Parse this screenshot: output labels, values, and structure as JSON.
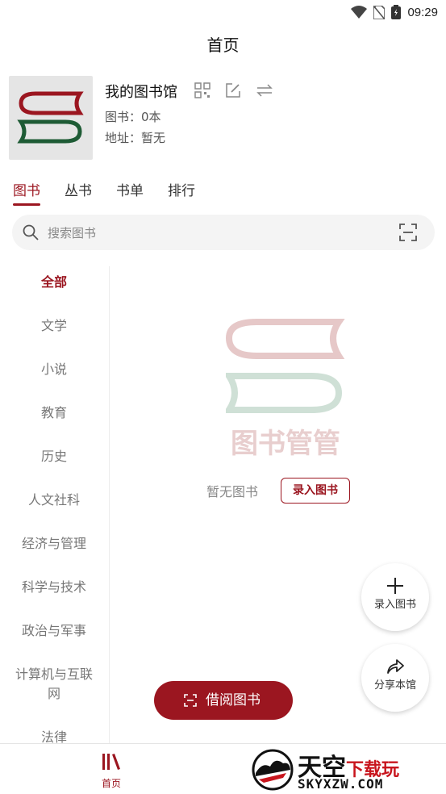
{
  "status": {
    "time": "09:29"
  },
  "page": {
    "title": "首页"
  },
  "library": {
    "name": "我的图书馆",
    "books": "图书：0本",
    "address": "地址：暂无"
  },
  "tabs": [
    {
      "label": "图书",
      "active": true
    },
    {
      "label": "丛书",
      "active": false
    },
    {
      "label": "书单",
      "active": false
    },
    {
      "label": "排行",
      "active": false
    }
  ],
  "search": {
    "placeholder": "搜索图书"
  },
  "categories": [
    {
      "label": "全部",
      "active": true
    },
    {
      "label": "文学"
    },
    {
      "label": "小说"
    },
    {
      "label": "教育"
    },
    {
      "label": "历史"
    },
    {
      "label": "人文社科"
    },
    {
      "label": "经济与管理"
    },
    {
      "label": "科学与技术"
    },
    {
      "label": "政治与军事"
    },
    {
      "label": "计算机与互联网"
    },
    {
      "label": "法律"
    }
  ],
  "empty": {
    "logo_text": "图书管管",
    "message": "暂无图书",
    "add_label": "录入图书"
  },
  "fabs": {
    "add_label": "录入图书",
    "share_label": "分享本馆"
  },
  "borrow": {
    "label": "借阅图书"
  },
  "nav": {
    "home_label": "首页"
  },
  "watermark": {
    "cn_black": "天空",
    "cn_red": "下载玩",
    "en": "SKYXZW.COM"
  },
  "colors": {
    "accent": "#9b1620",
    "logo_red": "#9b1620",
    "logo_green": "#1e5b35"
  }
}
